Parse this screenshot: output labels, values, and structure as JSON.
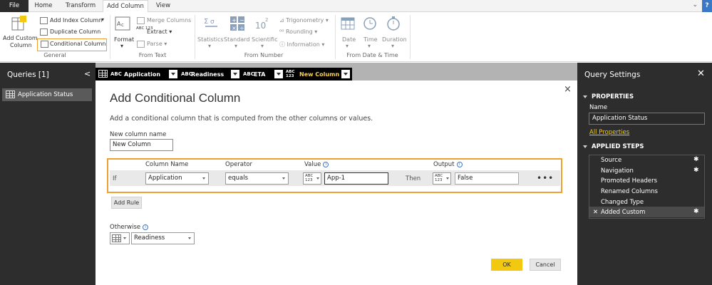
{
  "ribbon_tabs": [
    "File",
    "Home",
    "Transform",
    "Add Column",
    "View"
  ],
  "ribbon": {
    "add_custom_column": [
      "Add Custom",
      "Column"
    ],
    "add_index_column": "Add Index Column",
    "duplicate_column": "Duplicate Column",
    "conditional_column": "Conditional Column",
    "group_general": "General",
    "format": "Format",
    "merge_columns": "Merge Columns",
    "extract": "Extract",
    "parse": "Parse",
    "abc_123": "ABC 123",
    "group_from_text": "From Text",
    "statistics": "Statistics",
    "standard": "Standard",
    "scientific": "Scientific",
    "trigonometry": "Trigonometry",
    "rounding": "Rounding",
    "information": "Information",
    "group_from_number": "From Number",
    "date": "Date",
    "time": "Time",
    "duration": "Duration",
    "group_from_date_time": "From Date & Time",
    "collapse_glyph": "⌄",
    "help_glyph": "?"
  },
  "queries": {
    "title": "Queries [1]",
    "collapse_glyph": "<",
    "items": [
      "Application Status"
    ]
  },
  "column_headers": [
    {
      "type_glyph": "ABC",
      "name": "Application"
    },
    {
      "type_glyph": "ABC",
      "name": "Readiness"
    },
    {
      "type_glyph": "ABC",
      "name": "ETA"
    },
    {
      "type_glyph": "ABC 123",
      "name": "New Column"
    }
  ],
  "dialog": {
    "title": "Add Conditional Column",
    "close_glyph": "×",
    "description": "Add a conditional column that is computed from the other columns or values.",
    "new_column_name_label": "New column name",
    "new_column_name_value": "New Column",
    "headers": {
      "column_name": "Column Name",
      "operator": "Operator",
      "value": "Value",
      "output": "Output"
    },
    "info_glyph": "i",
    "rule": {
      "if_label": "If",
      "column_name": "Application",
      "operator": "equals",
      "value_type": "ABC 123",
      "value": "App-1",
      "then_label": "Then",
      "output_type": "ABC 123",
      "output": "False",
      "more_glyph": "•••"
    },
    "add_rule": "Add Rule",
    "otherwise_label": "Otherwise",
    "otherwise_value": "Readiness",
    "ok": "OK",
    "cancel": "Cancel"
  },
  "query_settings": {
    "title": "Query Settings",
    "close_glyph": "✕",
    "properties_heading": "PROPERTIES",
    "name_label": "Name",
    "name_value": "Application Status",
    "all_properties": "All Properties",
    "applied_steps_heading": "APPLIED STEPS",
    "steps": [
      "Source",
      "Navigation",
      "Promoted Headers",
      "Renamed Columns",
      "Changed Type",
      "Added Custom"
    ],
    "delete_step_glyph": "✕",
    "gear_glyph": "✱"
  }
}
